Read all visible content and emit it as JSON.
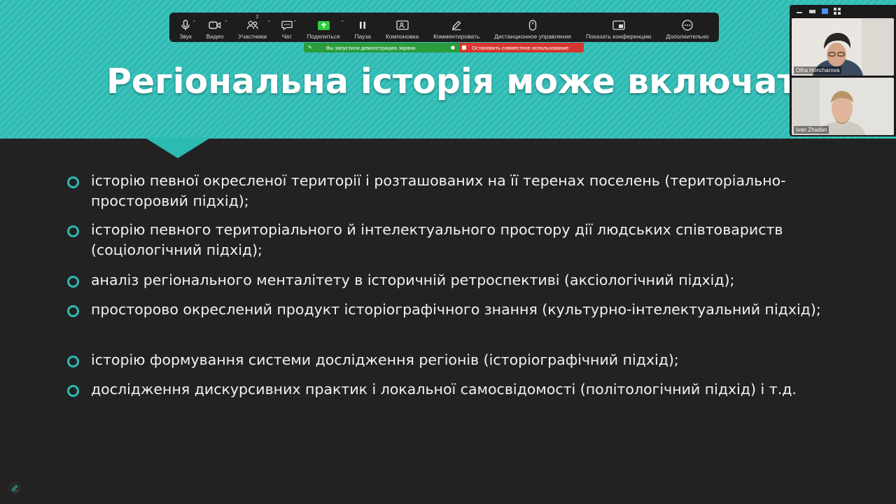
{
  "slide": {
    "title": "Регіональна історія може включати:",
    "bullets": [
      {
        "text": " історію певної окресленої території і розташованих на її теренах поселень (територіально-просторовий підхід);"
      },
      {
        "text": "історію певного територіального й інтелектуального простору дії людських співтовариств (соціологічний підхід);"
      },
      {
        "text": " аналіз регіонального менталітету в історичній ретроспективі (аксіологічний підхід);"
      },
      {
        "text": "просторово окреслений продукт історіографічного знання (культурно-інтелектуальний підхід);"
      },
      {
        "text": "історію формування системи дослідження регіонів (історіографічний підхід);"
      },
      {
        "text": "дослідження дискурсивних практик і локальної самосвідомості (політологічний підхід) і т.д."
      }
    ]
  },
  "toolbar": {
    "audio": "Звук",
    "video": "Видео",
    "participants": "Участники",
    "participants_count": "2",
    "chat": "Чат",
    "share": "Поделиться",
    "pause": "Пауза",
    "layout": "Компоновка",
    "annotate": "Комментировать",
    "remote_control": "Дистанционное управление",
    "show_conference": "Показать конференцию",
    "more": "Дополнительно"
  },
  "banner": {
    "sharing": "Вы запустили демонстрацию экрана",
    "stop": "Остановить совместное использование"
  },
  "participants": [
    {
      "name": "Olha Honcharova"
    },
    {
      "name": "Ivan Zhadan"
    }
  ],
  "colors": {
    "accent_teal": "#2cbbb3",
    "slide_bg": "#222222",
    "share_green": "#2ecc40",
    "stop_red": "#d8352e"
  }
}
